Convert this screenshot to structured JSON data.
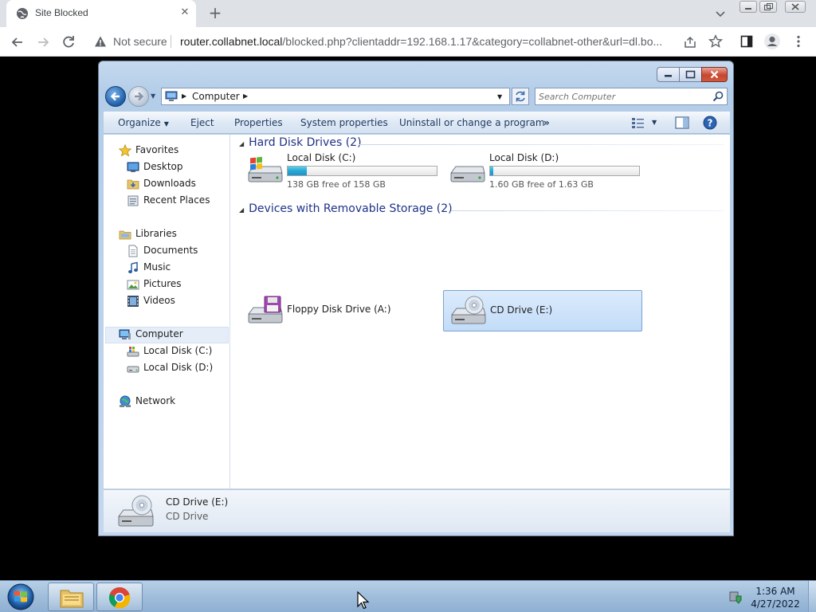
{
  "browser": {
    "tab_title": "Site Blocked",
    "security_label": "Not secure",
    "url_host": "router.collabnet.local",
    "url_rest": "/blocked.php?clientaddr=192.168.1.17&category=collabnet-other&url=dl.bo..."
  },
  "explorer": {
    "breadcrumb": "Computer",
    "search_placeholder": "Search Computer",
    "commands": {
      "organize": "Organize",
      "eject": "Eject",
      "properties": "Properties",
      "system_properties": "System properties",
      "uninstall": "Uninstall or change a program",
      "more": "»"
    },
    "nav": {
      "favorites": "Favorites",
      "desktop": "Desktop",
      "downloads": "Downloads",
      "recent_places": "Recent Places",
      "libraries": "Libraries",
      "documents": "Documents",
      "music": "Music",
      "pictures": "Pictures",
      "videos": "Videos",
      "computer": "Computer",
      "local_c": "Local Disk (C:)",
      "local_d": "Local Disk (D:)",
      "network": "Network"
    },
    "groups": {
      "hard_disks": "Hard Disk Drives (2)",
      "removable": "Devices with Removable Storage (2)"
    },
    "drives": {
      "c": {
        "name": "Local Disk (C:)",
        "free": "138 GB free of 158 GB",
        "used_fraction": 0.127
      },
      "d": {
        "name": "Local Disk (D:)",
        "free": "1.60 GB free of 1.63 GB",
        "used_fraction": 0.02
      },
      "a": {
        "name": "Floppy Disk Drive (A:)"
      },
      "e": {
        "name": "CD Drive (E:)"
      }
    },
    "details": {
      "name": "CD Drive (E:)",
      "type": "CD Drive"
    }
  },
  "taskbar": {
    "time": "1:36 AM",
    "date": "4/27/2022"
  }
}
